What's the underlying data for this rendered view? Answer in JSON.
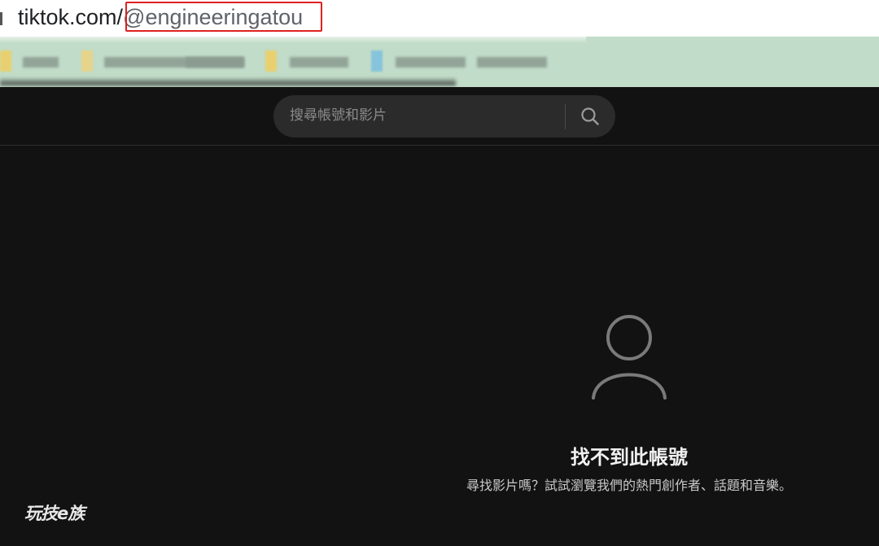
{
  "browser": {
    "url_domain": "tiktok.com/",
    "url_path": "@engineeringatou"
  },
  "header": {
    "search_placeholder": "搜尋帳號和影片"
  },
  "empty_state": {
    "title": "找不到此帳號",
    "description": "尋找影片嗎？試試瀏覽我們的熱門創作者、話題和音樂。"
  },
  "watermark": {
    "text": "玩技e族"
  },
  "colors": {
    "page_background": "#121212",
    "bookmarks_bar": "#c1dcc8",
    "highlight_border": "#e02020",
    "search_background": "#2b2b2b"
  },
  "icons": {
    "search": "search-icon",
    "profile": "person-icon"
  }
}
